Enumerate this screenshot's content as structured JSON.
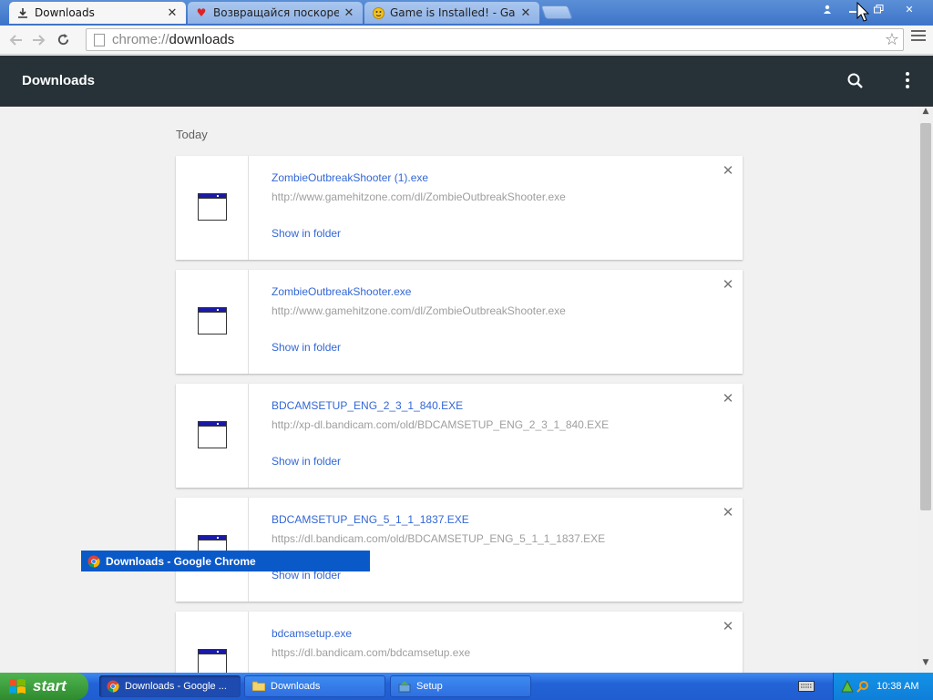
{
  "browser": {
    "tabs": [
      {
        "title": "Downloads",
        "icon": "download-icon",
        "active": true
      },
      {
        "title": "Возвращайся поскорее!",
        "icon": "heart-icon",
        "active": false
      },
      {
        "title": "Game is Installed! - GameHitZ",
        "icon": "smiley-icon",
        "active": false
      }
    ],
    "address": {
      "scheme": "chrome://",
      "path": "downloads"
    }
  },
  "downloads_page": {
    "title": "Downloads",
    "section_label": "Today",
    "items": [
      {
        "name": "ZombieOutbreakShooter (1).exe",
        "url": "http://www.gamehitzone.com/dl/ZombieOutbreakShooter.exe",
        "action": "Show in folder"
      },
      {
        "name": "ZombieOutbreakShooter.exe",
        "url": "http://www.gamehitzone.com/dl/ZombieOutbreakShooter.exe",
        "action": "Show in folder"
      },
      {
        "name": "BDCAMSETUP_ENG_2_3_1_840.EXE",
        "url": "http://xp-dl.bandicam.com/old/BDCAMSETUP_ENG_2_3_1_840.EXE",
        "action": "Show in folder"
      },
      {
        "name": "BDCAMSETUP_ENG_5_1_1_1837.EXE",
        "url": "https://dl.bandicam.com/old/BDCAMSETUP_ENG_5_1_1_1837.EXE",
        "action": "Show in folder"
      },
      {
        "name": "bdcamsetup.exe",
        "url": "https://dl.bandicam.com/bdcamsetup.exe",
        "action": ""
      }
    ]
  },
  "window_caption": "Downloads - Google Chrome",
  "taskbar": {
    "start_label": "start",
    "tasks": [
      {
        "label": "Downloads - Google ...",
        "icon": "chrome-icon",
        "active": true
      },
      {
        "label": "Downloads",
        "icon": "folder-icon",
        "active": false
      },
      {
        "label": "Setup",
        "icon": "setup-icon",
        "active": false
      }
    ],
    "clock": "10:38 AM"
  },
  "colors": {
    "header_bg": "#263238",
    "link": "#3367d6",
    "taskbar": "#2363d6",
    "start": "#2e8b2e"
  }
}
